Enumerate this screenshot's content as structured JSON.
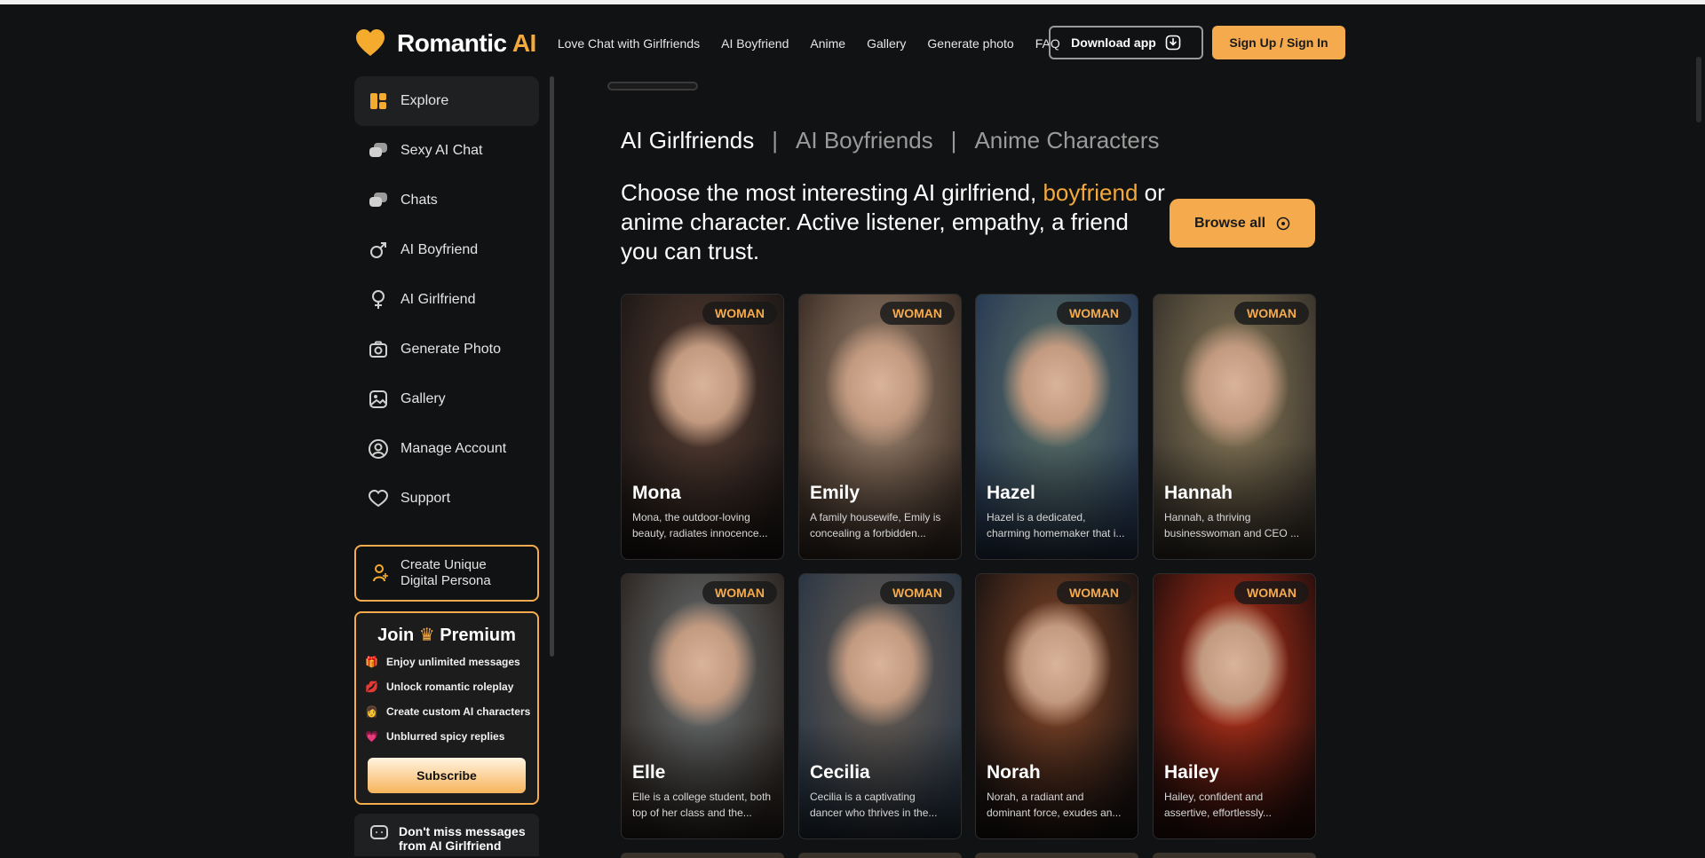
{
  "header": {
    "brand_main": "Romantic ",
    "brand_ai": "AI",
    "nav": [
      "Love Chat with Girlfriends",
      "AI Boyfriend",
      "Anime",
      "Gallery",
      "Generate photo",
      "FAQ"
    ],
    "download_label": "Download app",
    "sign_label": "Sign Up / Sign In"
  },
  "sidebar": {
    "items": [
      {
        "label": "Explore",
        "icon": "explore-icon"
      },
      {
        "label": "Sexy AI Chat",
        "icon": "chat-bubbles-icon"
      },
      {
        "label": "Chats",
        "icon": "chat-bubbles-icon"
      },
      {
        "label": "AI Boyfriend",
        "icon": "male-symbol-icon"
      },
      {
        "label": "AI Girlfriend",
        "icon": "female-symbol-icon"
      },
      {
        "label": "Generate Photo",
        "icon": "camera-icon"
      },
      {
        "label": "Gallery",
        "icon": "image-icon"
      },
      {
        "label": "Manage Account",
        "icon": "user-circle-icon"
      },
      {
        "label": "Support",
        "icon": "heart-support-icon"
      }
    ],
    "persona_line1": "Create Unique",
    "persona_line2": "Digital Persona",
    "premium": {
      "title_join": "Join",
      "title_premium": "Premium",
      "perks": [
        {
          "emoji": "🎁",
          "text": "Enjoy unlimited messages"
        },
        {
          "emoji": "💋",
          "text": "Unlock romantic roleplay"
        },
        {
          "emoji": "👩",
          "text": "Create custom AI characters"
        },
        {
          "emoji": "💗",
          "text": "Unblurred spicy replies"
        }
      ],
      "subscribe": "Subscribe"
    },
    "notify_line1": "Don't miss messages",
    "notify_line2": "from AI Girlfriend"
  },
  "main": {
    "tabs": [
      "AI Girlfriends",
      "AI Boyfriends",
      "Anime Characters"
    ],
    "tab_sep": "|",
    "headline_1": "Choose the most interesting AI girlfriend, ",
    "headline_hl": "boyfriend",
    "headline_2": " or anime character. Active listener, empathy, a friend you can trust.",
    "browse_label": "Browse all",
    "cards": [
      {
        "badge": "WOMAN",
        "name": "Mona",
        "desc": "Mona, the outdoor-loving beauty, radiates innocence...",
        "c1": "#5a4035",
        "c2": "#1e1816"
      },
      {
        "badge": "WOMAN",
        "name": "Emily",
        "desc": "A family housewife, Emily is concealing a forbidden...",
        "c1": "#a38872",
        "c2": "#3b2e26"
      },
      {
        "badge": "WOMAN",
        "name": "Hazel",
        "desc": "Hazel is a dedicated, charming homemaker that i...",
        "c1": "#5f7466",
        "c2": "#283a54"
      },
      {
        "badge": "WOMAN",
        "name": "Hannah",
        "desc": "Hannah, a thriving businesswoman and CEO ...",
        "c1": "#8b7c5a",
        "c2": "#3a342c"
      },
      {
        "badge": "WOMAN",
        "name": "Elle",
        "desc": "Elle is a college student, both top of her class and the...",
        "c1": "#6f7678",
        "c2": "#2d2622"
      },
      {
        "badge": "WOMAN",
        "name": "Cecilia",
        "desc": "Cecilia is a captivating dancer who thrives in the...",
        "c1": "#6e6155",
        "c2": "#2a3644"
      },
      {
        "badge": "WOMAN",
        "name": "Norah",
        "desc": "Norah, a radiant and dominant force, exudes an...",
        "c1": "#8a4a2a",
        "c2": "#1c1412"
      },
      {
        "badge": "WOMAN",
        "name": "Hailey",
        "desc": "Hailey, confident and assertive, effortlessly...",
        "c1": "#c2351c",
        "c2": "#2a0f0c"
      }
    ]
  }
}
